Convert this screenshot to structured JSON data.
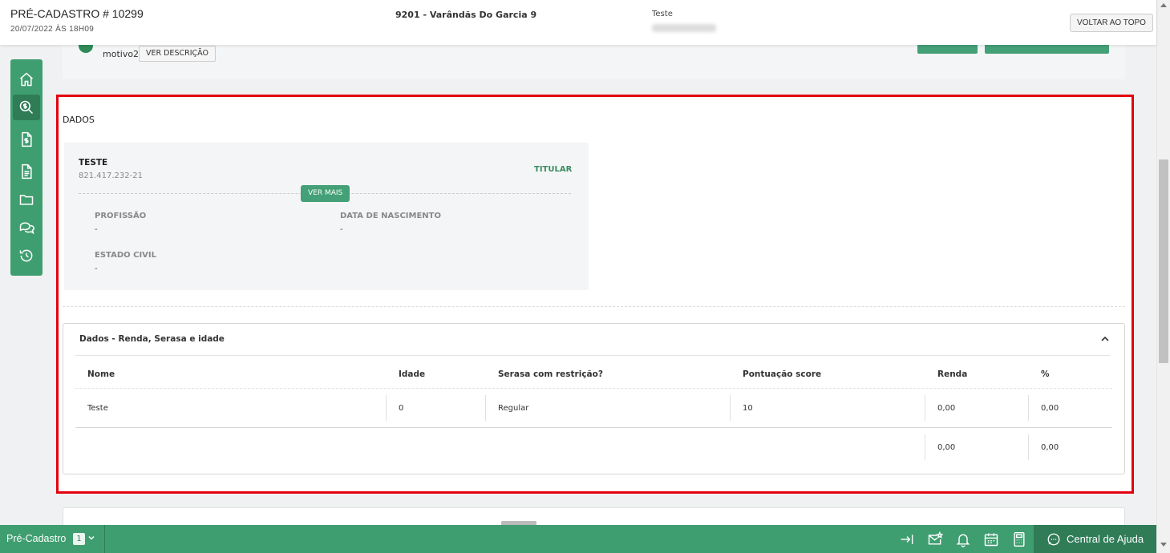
{
  "header": {
    "title": "PRÉ-CADASTRO # 10299",
    "datetime": "20/07/2022 ÀS 18H09",
    "center_label": "9201 - Varândãs Do Garcia 9",
    "user_name": "Teste",
    "back_to_top_label": "VOLTAR AO TOPO"
  },
  "sidebar": {
    "items": [
      {
        "icon": "home-icon"
      },
      {
        "icon": "money-search-icon",
        "active": true
      },
      {
        "icon": "invoice-icon"
      },
      {
        "icon": "document-icon"
      },
      {
        "icon": "folder-icon"
      },
      {
        "icon": "chat-icon"
      },
      {
        "icon": "history-icon"
      }
    ]
  },
  "top_panel": {
    "motivo_label": "motivo2",
    "ver_descricao_label": "VER DESCRIÇÃO"
  },
  "dados": {
    "section_title": "DADOS",
    "person": {
      "name": "TESTE",
      "cpf": "821.417.232-21",
      "role": "TITULAR",
      "ver_mais_label": "VER MAIS",
      "fields": [
        {
          "label": "PROFISSÃO",
          "value": "-"
        },
        {
          "label": "DATA DE NASCIMENTO",
          "value": "-"
        },
        {
          "label": "ESTADO CIVIL",
          "value": "-"
        }
      ]
    }
  },
  "renda": {
    "title": "Dados - Renda, Serasa e idade",
    "columns": [
      "Nome",
      "Idade",
      "Serasa com restrição?",
      "Pontuação score",
      "Renda",
      "%"
    ],
    "rows": [
      [
        "Teste",
        "0",
        "Regular",
        "10",
        "0,00",
        "0,00"
      ]
    ],
    "totals": {
      "renda": "0,00",
      "percent": "0,00"
    }
  },
  "taskbar": {
    "app_label": "Pré-Cadastro",
    "app_count": "1",
    "icons": [
      "collapse-right-icon",
      "mail-star-icon",
      "bell-icon",
      "calendar-icon",
      "calculator-icon"
    ],
    "help_label": "Central de Ajuda"
  },
  "colors": {
    "primary": "#3f9e70",
    "primary_dark": "#2f7c57",
    "highlight_border": "#e3000f"
  }
}
